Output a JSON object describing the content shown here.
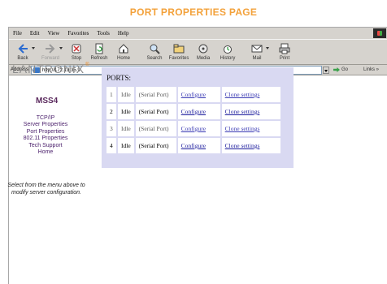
{
  "page_heading": "PORT PROPERTIES PAGE",
  "browser": {
    "menu": [
      "File",
      "Edit",
      "View",
      "Favorites",
      "Tools",
      "Help"
    ],
    "toolbar": [
      {
        "label": "Back",
        "icon": "back-arrow-icon",
        "enabled": true
      },
      {
        "label": "Forward",
        "icon": "forward-arrow-icon",
        "enabled": false
      },
      {
        "label": "Stop",
        "icon": "stop-icon",
        "enabled": true
      },
      {
        "label": "Refresh",
        "icon": "refresh-icon",
        "enabled": true
      },
      {
        "label": "Home",
        "icon": "home-icon",
        "enabled": true
      },
      {
        "label": "Search",
        "icon": "search-icon",
        "enabled": true
      },
      {
        "label": "Favorites",
        "icon": "favorites-icon",
        "enabled": true
      },
      {
        "label": "Media",
        "icon": "media-icon",
        "enabled": true
      },
      {
        "label": "History",
        "icon": "history-icon",
        "enabled": true
      },
      {
        "label": "Mail",
        "icon": "mail-icon",
        "enabled": true
      },
      {
        "label": "Print",
        "icon": "print-icon",
        "enabled": true
      }
    ],
    "address_label": "Address",
    "address_value": "http://172.19.35.9",
    "go_label": "Go",
    "links_label": "Links »"
  },
  "sidebar": {
    "logo_text": "LANTRONIX",
    "logo_mark": "®",
    "model": "MSS4",
    "nav": [
      "TCP/IP",
      "Server Properties",
      "Port Properties",
      "802.11 Properties",
      "Tech Support",
      "Home"
    ],
    "help_text": "Select from the menu above to modify server configuration."
  },
  "ports": {
    "title": "PORTS:",
    "rows": [
      {
        "num": "1",
        "state": "Idle",
        "type": "(Serial Port)",
        "configure": "Configure",
        "clone": "Clone settings"
      },
      {
        "num": "2",
        "state": "Idle",
        "type": "(Serial Port)",
        "configure": "Configure",
        "clone": "Clone settings"
      },
      {
        "num": "3",
        "state": "Idle",
        "type": "(Serial Port)",
        "configure": "Configure",
        "clone": "Clone settings"
      },
      {
        "num": "4",
        "state": "Idle",
        "type": "(Serial Port)",
        "configure": "Configure",
        "clone": "Clone settings"
      }
    ]
  },
  "colors": {
    "heading": "#f3a13a",
    "panel_bg": "#d9d9f2",
    "nav_link": "#4a1f6b",
    "model": "#5b2a5e",
    "link": "#1a1a9c"
  }
}
